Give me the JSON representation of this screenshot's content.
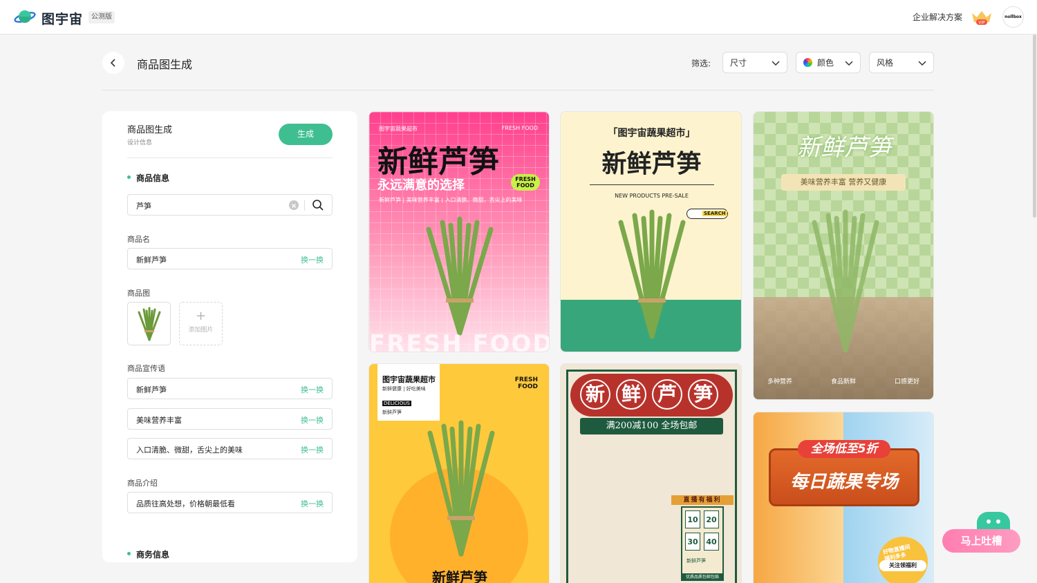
{
  "topbar": {
    "brand": "图宇宙",
    "beta": "公测版",
    "business_link": "企业解决方案",
    "vip_badge": "VIP",
    "avatar_text": "nollbox"
  },
  "header": {
    "title": "商品图生成",
    "filter_label": "筛选:",
    "size_label": "尺寸",
    "color_label": "颜色",
    "style_label": "风格"
  },
  "panel": {
    "title": "商品图生成",
    "subtitle": "设计信息",
    "generate_label": "生成",
    "product_section": "商品信息",
    "search_value": "芦笋",
    "name_label": "商品名",
    "name_value": "新鲜芦笋",
    "swap_label": "换一换",
    "image_label": "商品图",
    "add_image_label": "添加图片",
    "slogan_label": "商品宣传语",
    "slogans": [
      "新鲜芦笋",
      "美味营养丰富",
      "入口清脆、微甜，舌尖上的美味"
    ],
    "intro_label": "商品介绍",
    "intro_value": "品质往高处想，价格朝最低看",
    "business_section": "商务信息"
  },
  "cards": {
    "c1": {
      "store": "图宇宙蔬果超市",
      "tag_top": "FRESH FOOD",
      "title": "新鲜芦笋",
      "slogan": "永远满意的选择",
      "badge_l1": "FRESH",
      "badge_l2": "FOOD",
      "desc": "新鲜芦笋 | 美味营养丰富 | 入口清脆、微甜，舌尖上的美味",
      "watermark": "FRESH FOOD"
    },
    "c2": {
      "store": "「图宇宙蔬果超市」",
      "title": "新鲜芦笋",
      "subtitle": "NEW PRODUCTS PRE-SALE",
      "search_tag": "SEARCH"
    },
    "c3": {
      "title": "新鲜芦笋",
      "ribbon": "美味营养丰富 营养又健康",
      "icons": [
        "多种营养",
        "食品新鲜",
        "口感更好"
      ]
    },
    "c4": {
      "store": "图宇宙蔬果超市",
      "line1": "新鲜健康 | 好吃美味",
      "tag": "DELICIOUS",
      "line2": "新鲜芦笋",
      "corner_l1": "FRESH",
      "corner_l2": "FOOD",
      "bottom_title": "新鲜芦笋"
    },
    "c5": {
      "title_chars": [
        "新",
        "鲜",
        "芦",
        "笋"
      ],
      "promo": "满200减100 全场包邮",
      "live": "直播有福利",
      "coupons": [
        "10",
        "20",
        "30",
        "40"
      ],
      "coupon_item": "新鲜芦笋",
      "footer": "优质品质包邮包赔"
    },
    "c6": {
      "banner_top": "全场低至5折",
      "banner_main": "每日蔬果专场",
      "badge_l1": "好物直播间",
      "badge_l2": "福利多多",
      "badge_btn": "关注领福利"
    }
  },
  "feedback": {
    "label": "马上吐槽"
  }
}
